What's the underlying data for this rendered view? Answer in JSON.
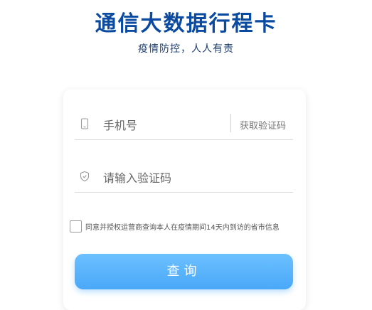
{
  "header": {
    "title": "通信大数据行程卡",
    "subtitle": "疫情防控，人人有责"
  },
  "form": {
    "phone": {
      "placeholder": "手机号",
      "icon": "phone-icon"
    },
    "get_code_label": "获取验证码",
    "code": {
      "placeholder": "请输入验证码",
      "icon": "shield-icon"
    },
    "agreement": {
      "checked": false,
      "text": "同意并授权运营商查询本人在疫情期间14天内到访的省市信息"
    },
    "submit_label": "查询"
  },
  "colors": {
    "title": "#0a4aa0",
    "button": "#4aa8f8"
  }
}
